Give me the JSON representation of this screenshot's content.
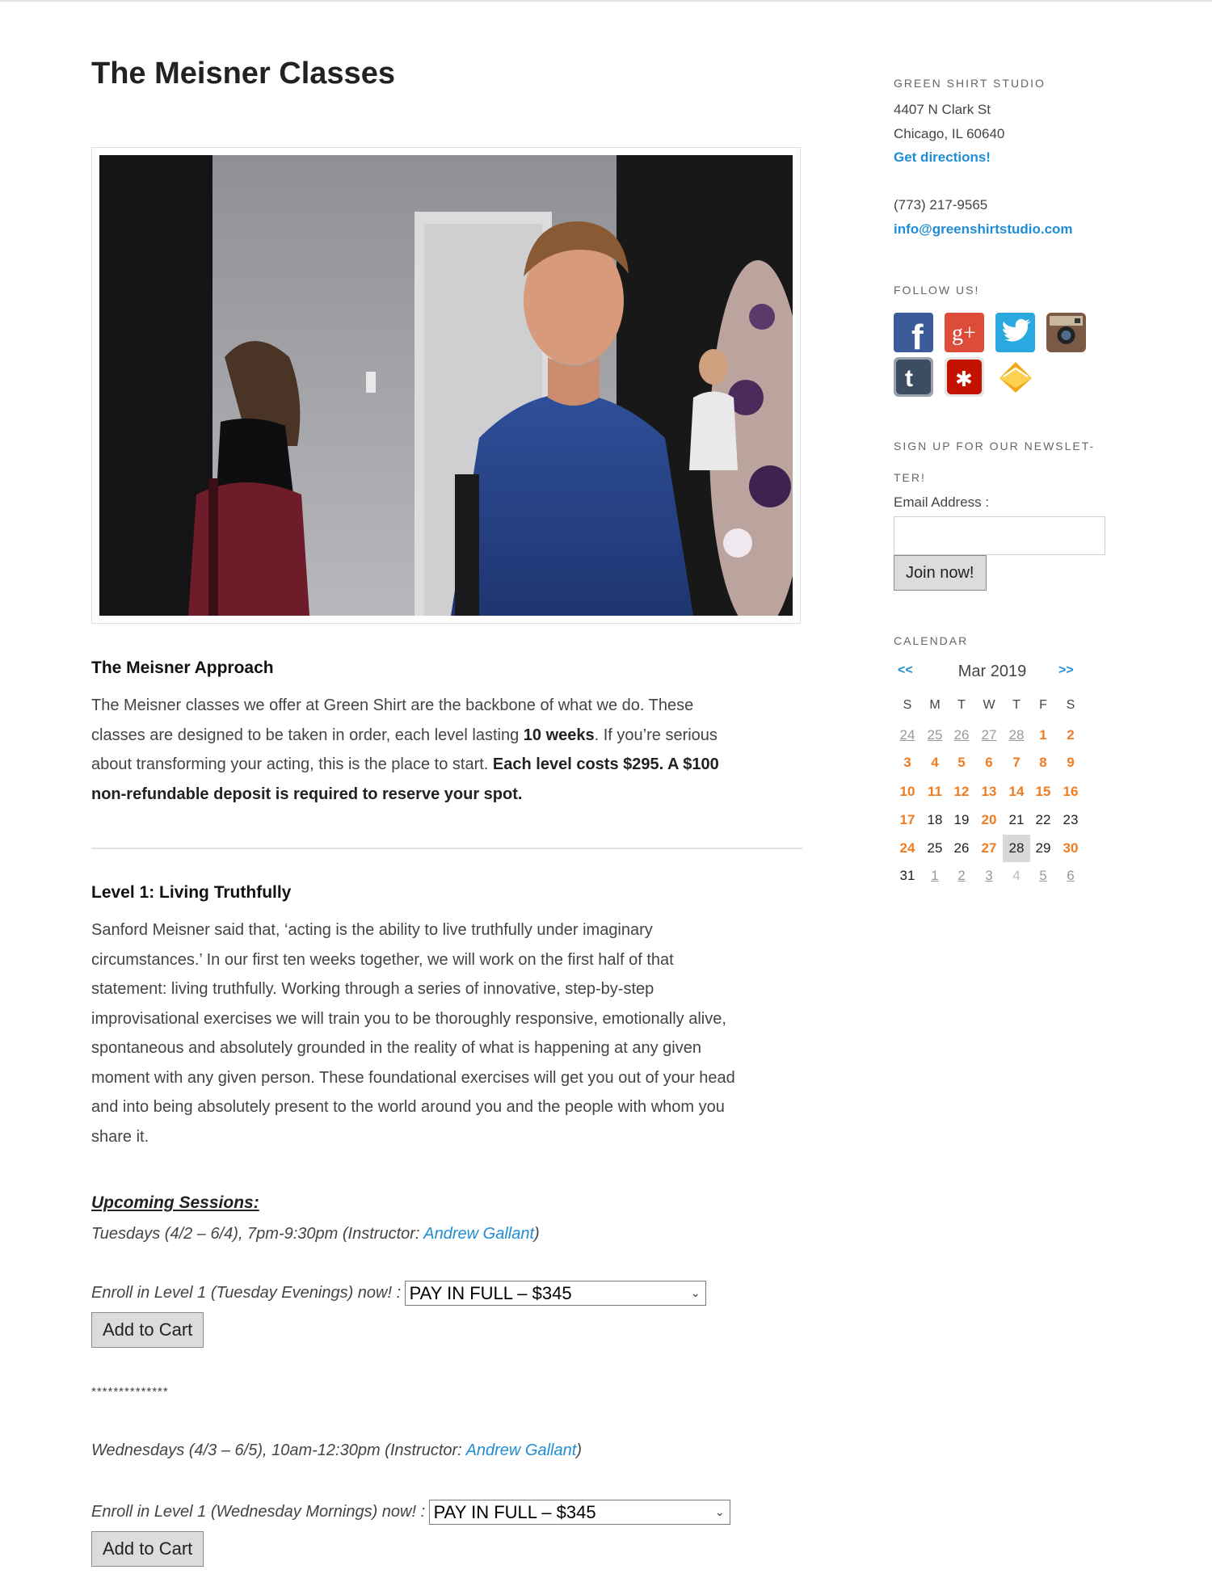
{
  "page": {
    "title": "The Meisner Classes",
    "photo_alt": ""
  },
  "approach": {
    "heading": "The Meisner Approach",
    "p1": "The Meisner classes we offer at Green Shirt are the backbone of what we do. These",
    "p2_pre": "classes are designed to be taken in order, each level lasting ",
    "p2_bold": "10 weeks",
    "p2_post": ". If you’re serious",
    "p3_pre": "about transforming your acting, this is the place to start. ",
    "p3_bold": "Each level costs $295. A $100",
    "p4_bold": "non-refundable deposit is required to reserve your spot."
  },
  "level1": {
    "heading": "Level 1: Living Truthfully",
    "lines": [
      "Sanford Meisner said that, ‘acting is the ability to live truthfully under imaginary",
      "circumstances.’ In our first ten weeks together, we will work on the first half of that",
      "statement: living truthfully. Working through a series of innovative, step-by-step",
      "improvisational exercises we will train you to be thoroughly responsive, emotionally alive,",
      "spontaneous and absolutely grounded in the reality of what is happening at any given",
      "moment with any given person. These foundational exercises will get you out of your head",
      "and into being absolutely present to the world around you and the people with whom you",
      "share it."
    ]
  },
  "sessions": {
    "heading": "Upcoming Sessions:",
    "tuesday": {
      "line_pre": "Tuesdays (4/2 – 6/4), 7pm-9:30pm (Instructor: ",
      "instructor": "Andrew Gallant",
      "line_post": ")",
      "enroll_label": "Enroll in Level 1 (Tuesday Evenings) now! :",
      "select_value": "PAY IN FULL – $345",
      "button": "Add to Cart"
    },
    "separator": "**************",
    "wednesday": {
      "line_pre": "Wednesdays (4/3 – 6/5), 10am-12:30pm (Instructor: ",
      "instructor": "Andrew Gallant",
      "line_post": ")",
      "enroll_label": "Enroll in Level 1 (Wednesday Mornings) now! :",
      "select_value": "PAY IN FULL – $345",
      "button": "Add to Cart"
    }
  },
  "sidebar": {
    "studio_title": "GREEN SHIRT STUDIO",
    "address1": "4407 N Clark St",
    "address2": "Chicago, IL 60640",
    "directions": "Get directions!",
    "phone": "(773) 217-9565",
    "email": "info@greenshirtstudio.com",
    "follow_title": "FOLLOW US!",
    "social_icons": [
      "facebook-icon",
      "google-plus-icon",
      "twitter-icon",
      "instagram-icon",
      "tumblr-icon",
      "yelp-icon",
      "email-icon"
    ],
    "newsletter_title_1": "SIGN UP FOR OUR NEWSLET-",
    "newsletter_title_2": "TER!",
    "email_label": "Email Address :",
    "email_value": "",
    "join_button": "Join now!",
    "calendar_title": "CALENDAR"
  },
  "calendar": {
    "prev": "<<",
    "next": ">>",
    "month": "Mar 2019",
    "weekdays": [
      "S",
      "M",
      "T",
      "W",
      "T",
      "F",
      "S"
    ],
    "weeks": [
      [
        {
          "d": "24",
          "t": "other"
        },
        {
          "d": "25",
          "t": "other"
        },
        {
          "d": "26",
          "t": "other"
        },
        {
          "d": "27",
          "t": "other"
        },
        {
          "d": "28",
          "t": "other"
        },
        {
          "d": "1",
          "t": "event"
        },
        {
          "d": "2",
          "t": "event"
        }
      ],
      [
        {
          "d": "3",
          "t": "event"
        },
        {
          "d": "4",
          "t": "event"
        },
        {
          "d": "5",
          "t": "event"
        },
        {
          "d": "6",
          "t": "event"
        },
        {
          "d": "7",
          "t": "event"
        },
        {
          "d": "8",
          "t": "event"
        },
        {
          "d": "9",
          "t": "event"
        }
      ],
      [
        {
          "d": "10",
          "t": "event"
        },
        {
          "d": "11",
          "t": "event"
        },
        {
          "d": "12",
          "t": "event"
        },
        {
          "d": "13",
          "t": "event"
        },
        {
          "d": "14",
          "t": "event"
        },
        {
          "d": "15",
          "t": "event"
        },
        {
          "d": "16",
          "t": "event"
        }
      ],
      [
        {
          "d": "17",
          "t": "event"
        },
        {
          "d": "18",
          "t": "cur"
        },
        {
          "d": "19",
          "t": "cur"
        },
        {
          "d": "20",
          "t": "event"
        },
        {
          "d": "21",
          "t": "cur"
        },
        {
          "d": "22",
          "t": "cur"
        },
        {
          "d": "23",
          "t": "cur"
        }
      ],
      [
        {
          "d": "24",
          "t": "event"
        },
        {
          "d": "25",
          "t": "cur"
        },
        {
          "d": "26",
          "t": "cur"
        },
        {
          "d": "27",
          "t": "event"
        },
        {
          "d": "28",
          "t": "today"
        },
        {
          "d": "29",
          "t": "cur"
        },
        {
          "d": "30",
          "t": "event"
        }
      ],
      [
        {
          "d": "31",
          "t": "cur"
        },
        {
          "d": "1",
          "t": "other"
        },
        {
          "d": "2",
          "t": "other"
        },
        {
          "d": "3",
          "t": "other"
        },
        {
          "d": "4",
          "t": "dim"
        },
        {
          "d": "5",
          "t": "other"
        },
        {
          "d": "6",
          "t": "other"
        }
      ]
    ]
  },
  "colors": {
    "link": "#1f8dd6",
    "calendar_event": "#f07c22",
    "today_bg": "#d8d8d8"
  }
}
